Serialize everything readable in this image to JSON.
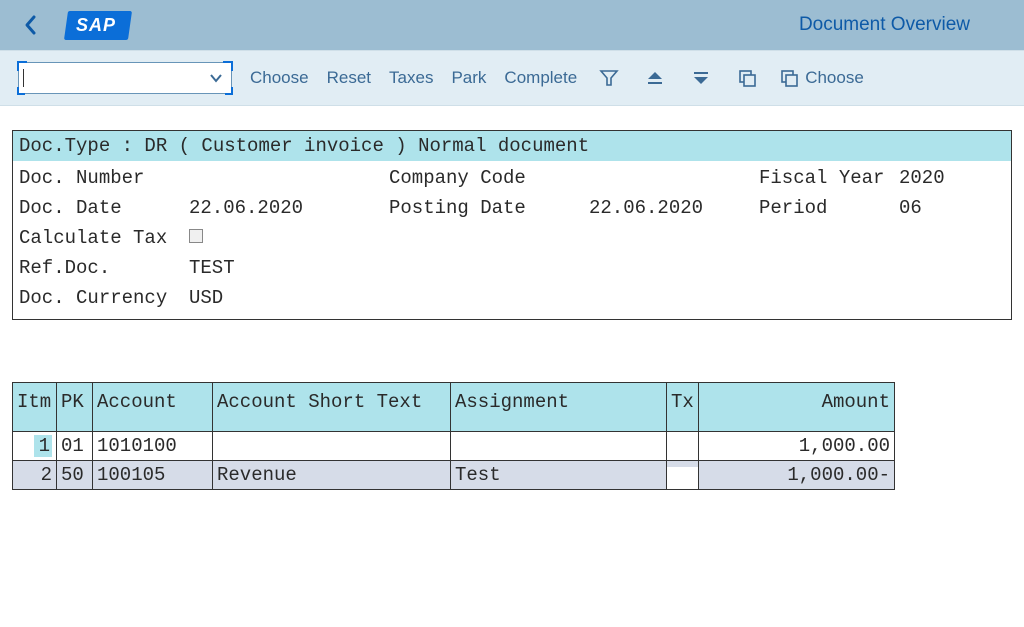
{
  "header": {
    "title": "Document Overview",
    "logo_text": "SAP"
  },
  "toolbar": {
    "choose": "Choose",
    "reset": "Reset",
    "taxes": "Taxes",
    "park": "Park",
    "complete": "Complete",
    "choose2": "Choose"
  },
  "doc": {
    "type_line": "Doc.Type : DR ( Customer invoice ) Normal document",
    "doc_number_label": "Doc. Number",
    "company_code_label": "Company Code",
    "fiscal_year_label": "Fiscal Year",
    "fiscal_year_value": "2020",
    "doc_date_label": "Doc. Date",
    "doc_date_value": "22.06.2020",
    "posting_date_label": "Posting Date",
    "posting_date_value": "22.06.2020",
    "period_label": "Period",
    "period_value": "06",
    "calc_tax_label": "Calculate Tax",
    "ref_doc_label": "Ref.Doc.",
    "ref_doc_value": "TEST",
    "currency_label": "Doc. Currency",
    "currency_value": "USD"
  },
  "table": {
    "headers": {
      "itm": "Itm",
      "pk": "PK",
      "account": "Account",
      "short_text": "Account Short Text",
      "assignment": "Assignment",
      "tx": "Tx",
      "amount": "Amount"
    },
    "rows": [
      {
        "itm": "1",
        "pk": "01",
        "account": "1010100",
        "short_text": "",
        "assignment": "",
        "tx": "",
        "amount": "1,000.00"
      },
      {
        "itm": "2",
        "pk": "50",
        "account": "100105",
        "short_text": "Revenue",
        "assignment": "Test",
        "tx": "",
        "amount": "1,000.00-"
      }
    ]
  }
}
